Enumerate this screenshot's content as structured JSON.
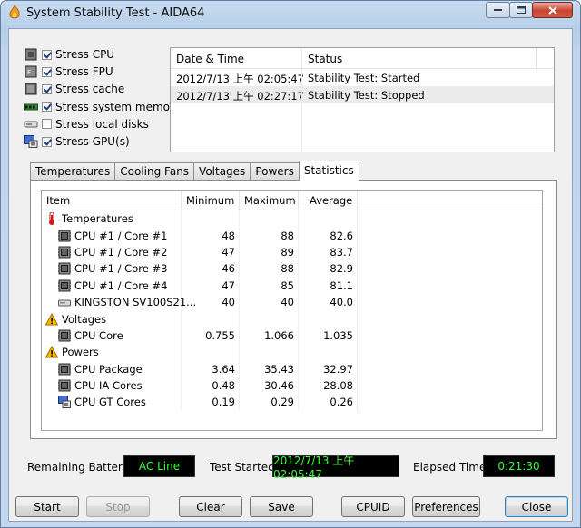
{
  "window": {
    "title": "System Stability Test - AIDA64"
  },
  "stress_options": [
    {
      "label": "Stress CPU",
      "checked": true,
      "icon": "cpu-chip-icon"
    },
    {
      "label": "Stress FPU",
      "checked": true,
      "icon": "fpu-chip-icon"
    },
    {
      "label": "Stress cache",
      "checked": true,
      "icon": "cache-icon"
    },
    {
      "label": "Stress system memory",
      "checked": true,
      "icon": "memory-module-icon"
    },
    {
      "label": "Stress local disks",
      "checked": false,
      "icon": "hard-disk-icon"
    },
    {
      "label": "Stress GPU(s)",
      "checked": true,
      "icon": "gpu-monitor-icon"
    }
  ],
  "log": {
    "columns": [
      "Date & Time",
      "Status"
    ],
    "rows": [
      {
        "time": "2012/7/13 上午 02:05:47",
        "status": "Stability Test: Started"
      },
      {
        "time": "2012/7/13 上午 02:27:17",
        "status": "Stability Test: Stopped"
      }
    ]
  },
  "tabs": [
    "Temperatures",
    "Cooling Fans",
    "Voltages",
    "Powers",
    "Statistics"
  ],
  "active_tab": "Statistics",
  "stats": {
    "columns": [
      "Item",
      "Minimum",
      "Maximum",
      "Average"
    ],
    "rows": [
      {
        "type": "group",
        "icon": "thermometer-icon",
        "item": "Temperatures"
      },
      {
        "type": "row",
        "icon": "cpu-chip-icon",
        "item": "CPU #1 / Core #1",
        "min": "48",
        "max": "88",
        "avg": "82.6"
      },
      {
        "type": "row",
        "icon": "cpu-chip-icon",
        "item": "CPU #1 / Core #2",
        "min": "47",
        "max": "89",
        "avg": "83.7"
      },
      {
        "type": "row",
        "icon": "cpu-chip-icon",
        "item": "CPU #1 / Core #3",
        "min": "46",
        "max": "88",
        "avg": "82.9"
      },
      {
        "type": "row",
        "icon": "cpu-chip-icon",
        "item": "CPU #1 / Core #4",
        "min": "47",
        "max": "85",
        "avg": "81.1"
      },
      {
        "type": "row",
        "icon": "disk-drive-icon",
        "item": "KINGSTON SV100S21...",
        "min": "40",
        "max": "40",
        "avg": "40.0"
      },
      {
        "type": "group",
        "icon": "warning-icon",
        "item": "Voltages"
      },
      {
        "type": "row",
        "icon": "cpu-chip-icon",
        "item": "CPU Core",
        "min": "0.755",
        "max": "1.066",
        "avg": "1.035"
      },
      {
        "type": "group",
        "icon": "warning-icon",
        "item": "Powers"
      },
      {
        "type": "row",
        "icon": "cpu-chip-icon",
        "item": "CPU Package",
        "min": "3.64",
        "max": "35.43",
        "avg": "32.97"
      },
      {
        "type": "row",
        "icon": "cpu-chip-icon",
        "item": "CPU IA Cores",
        "min": "0.48",
        "max": "30.46",
        "avg": "28.08"
      },
      {
        "type": "row",
        "icon": "gpu-monitor-icon",
        "item": "CPU GT Cores",
        "min": "0.19",
        "max": "0.29",
        "avg": "0.26"
      }
    ]
  },
  "status_bar": {
    "battery_label": "Remaining Battery:",
    "battery_value": "AC Line",
    "started_label": "Test Started:",
    "started_value": "2012/7/13 上午 02:05:47",
    "elapsed_label": "Elapsed Time:",
    "elapsed_value": "0:21:30"
  },
  "buttons": {
    "start": "Start",
    "stop": "Stop",
    "clear": "Clear",
    "save": "Save",
    "cpuid": "CPUID",
    "preferences": "Preferences",
    "close": "Close"
  },
  "colors": {
    "lcd_background": "#000000",
    "lcd_text": "#3cff3c"
  }
}
